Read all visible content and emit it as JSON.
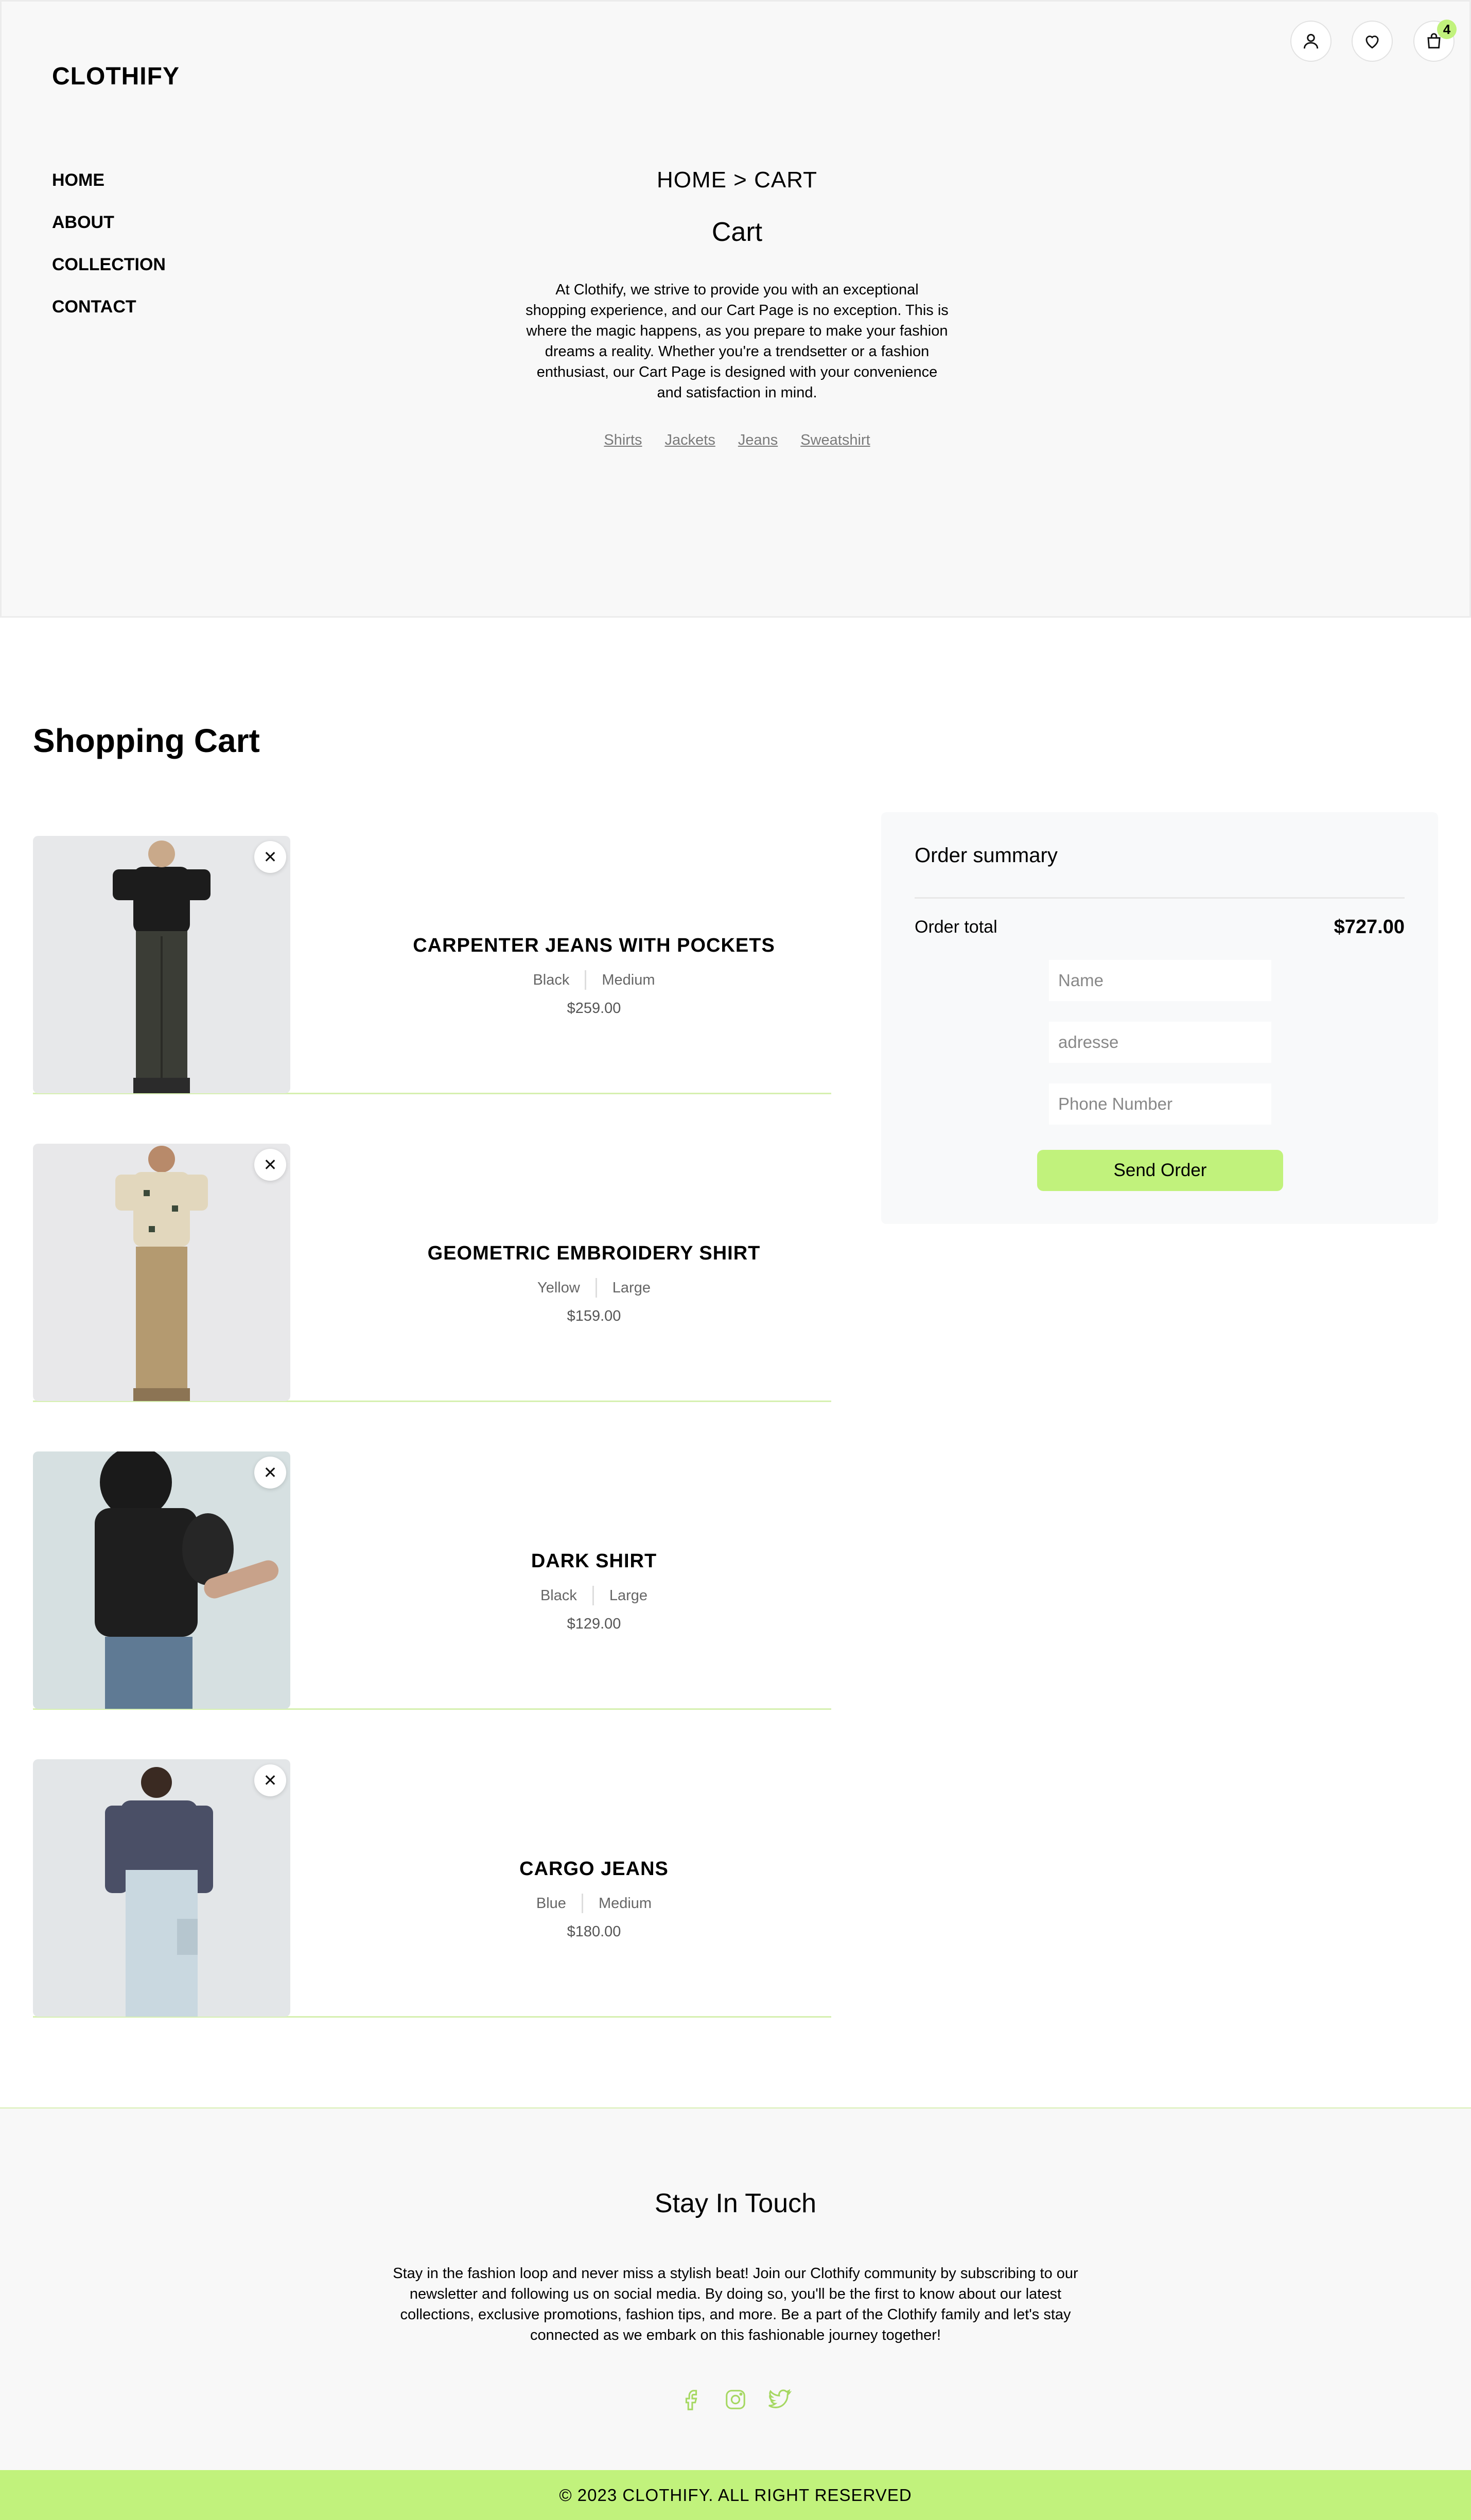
{
  "brand": "CLOTHIFY",
  "accent_color": "#c1f27c",
  "nav": [
    "HOME",
    "ABOUT",
    "COLLECTION",
    "CONTACT"
  ],
  "header_icons": {
    "account": "user-icon",
    "wishlist": "heart-icon",
    "cart": "shopping-bag-icon",
    "cart_count": "4"
  },
  "hero": {
    "breadcrumb": "HOME > CART",
    "title": "Cart",
    "description": "At Clothify, we strive to provide you with an exceptional shopping experience, and our Cart Page is no exception. This is where the magic happens, as you prepare to make your fashion dreams a reality. Whether you're a trendsetter or a fashion enthusiast, our Cart Page is designed with your convenience and satisfaction in mind.",
    "categories": [
      "Shirts",
      "Jackets",
      "Jeans",
      "Sweatshirt"
    ]
  },
  "cart": {
    "title": "Shopping Cart",
    "remove_icon": "close-icon",
    "items": [
      {
        "name": "CARPENTER JEANS WITH POCKETS",
        "color": "Black",
        "size": "Medium",
        "price": "$259.00"
      },
      {
        "name": "GEOMETRIC EMBROIDERY SHIRT",
        "color": "Yellow",
        "size": "Large",
        "price": "$159.00"
      },
      {
        "name": "DARK SHIRT",
        "color": "Black",
        "size": "Large",
        "price": "$129.00"
      },
      {
        "name": "CARGO JEANS",
        "color": "Blue",
        "size": "Medium",
        "price": "$180.00"
      }
    ]
  },
  "summary": {
    "title": "Order summary",
    "total_label": "Order total",
    "total_value": "$727.00",
    "name_placeholder": "Name",
    "address_placeholder": "adresse",
    "phone_placeholder": "Phone Number",
    "button": "Send Order"
  },
  "footer": {
    "title": "Stay In Touch",
    "text": "Stay in the fashion loop and never miss a stylish beat! Join our Clothify community by subscribing to our newsletter and following us on social media. By doing so, you'll be the first to know about our latest collections, exclusive promotions, fashion tips, and more. Be a part of the Clothify family and let's stay connected as we embark on this fashionable journey together!",
    "social_icons": [
      "facebook-icon",
      "instagram-icon",
      "twitter-icon"
    ],
    "copyright": "© 2023 CLOTHIFY. ALL RIGHT RESERVED"
  }
}
